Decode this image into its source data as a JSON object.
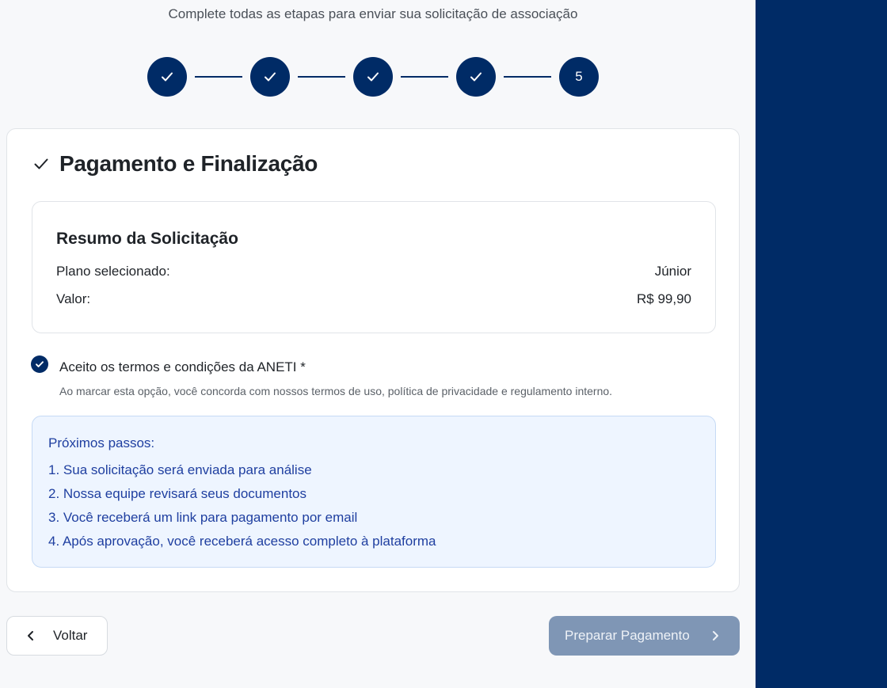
{
  "header": {
    "subtitle": "Complete todas as etapas para enviar sua solicitação de associação"
  },
  "stepper": {
    "steps": [
      {
        "state": "complete",
        "icon": "check-icon"
      },
      {
        "state": "complete",
        "icon": "check-icon"
      },
      {
        "state": "complete",
        "icon": "check-icon"
      },
      {
        "state": "complete",
        "icon": "check-icon"
      },
      {
        "state": "current",
        "label": "5"
      }
    ]
  },
  "card": {
    "title": "Pagamento e Finalização",
    "summary": {
      "title": "Resumo da Solicitação",
      "plan_label": "Plano selecionado:",
      "plan_value": "Júnior",
      "price_label": "Valor:",
      "price_value": "R$ 99,90"
    },
    "terms": {
      "checked": true,
      "label": "Aceito os termos e condições da ANETI *",
      "description": "Ao marcar esta opção, você concorda com nossos termos de uso, política de privacidade e regulamento interno."
    },
    "next_steps": {
      "title": "Próximos passos:",
      "items": [
        "1. Sua solicitação será enviada para análise",
        "2. Nossa equipe revisará seus documentos",
        "3. Você receberá um link para pagamento por email",
        "4. Após aprovação, você receberá acesso completo à plataforma"
      ]
    }
  },
  "footer": {
    "back_label": "Voltar",
    "next_label": "Preparar Pagamento"
  },
  "colors": {
    "primary": "#002b66",
    "disabled_button": "#7f96b5",
    "info_text": "#1f3fa0",
    "info_bg": "#eef5ff"
  }
}
